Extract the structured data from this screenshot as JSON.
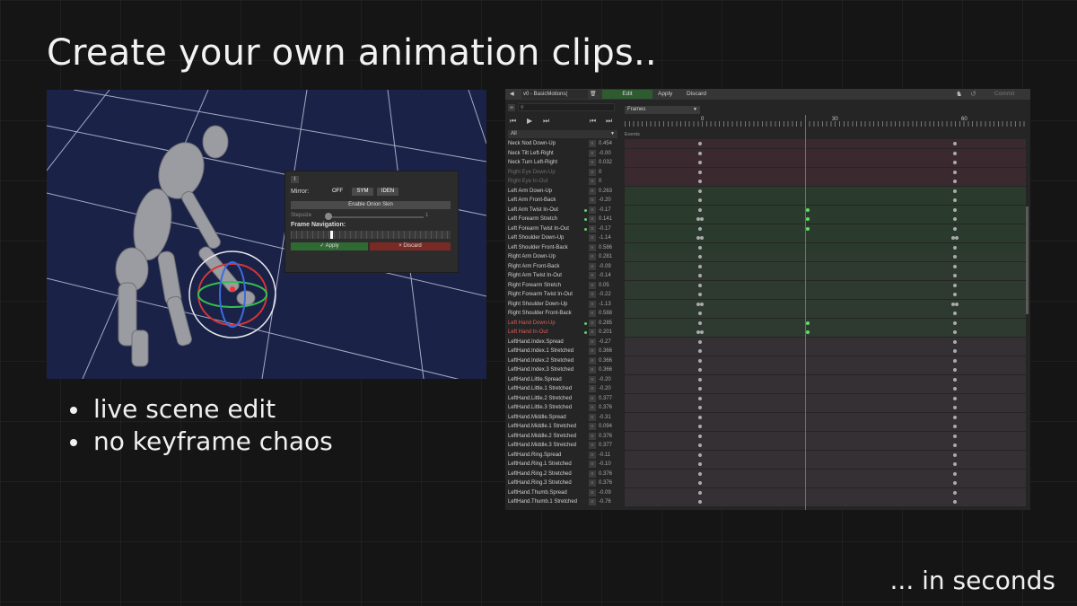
{
  "slide": {
    "title": "Create your own animation clips..",
    "bullets": [
      "live scene edit",
      "no keyframe chaos"
    ],
    "tagline": "... in seconds"
  },
  "gizmo_panel": {
    "close_label": "I",
    "mirror_label": "Mirror:",
    "mirror_options": [
      "OFF",
      "SYM",
      "IDEN"
    ],
    "onion_skin_label": "Enable Onion Skin",
    "stepsize_label": "Stepsize",
    "stepsize_value": "1",
    "frame_nav_label": "Frame Navigation:",
    "apply_label": "✓ Apply",
    "discard_label": "× Discard"
  },
  "editor": {
    "clip_name": "v0 - BasicMotions(",
    "toolbar": {
      "edit": "Edit",
      "apply": "Apply",
      "discard": "Discard",
      "commit": "Commit"
    },
    "filter_value": "All",
    "frames_dropdown": "Frames",
    "ruler_labels": [
      "0",
      "30",
      "60"
    ],
    "events_label": "Events",
    "keyframe_columns": [
      0,
      30,
      60
    ],
    "tracks": [
      {
        "name": "Neck Nod Down-Up",
        "value": "0.454",
        "style": "",
        "keys": "k0 k60"
      },
      {
        "name": "Neck Tilt Left-Right",
        "value": "-0.00",
        "style": "",
        "keys": "k0 k60"
      },
      {
        "name": "Neck Turn Left-Right",
        "value": "0.032",
        "style": "",
        "keys": "k0 k60"
      },
      {
        "name": "Right Eye Down-Up",
        "value": "0",
        "style": "dim",
        "keys": "k0 k60"
      },
      {
        "name": "Right Eye In-Out",
        "value": "0",
        "style": "dim",
        "keys": "k0 k60"
      },
      {
        "name": "Left Arm Down-Up",
        "value": "0.263",
        "style": "",
        "keys": "k0 k60"
      },
      {
        "name": "Left Arm Front-Back",
        "value": "-0.20",
        "style": "",
        "keys": "k0 k60"
      },
      {
        "name": "Left Arm Twist In-Out",
        "value": "-0.17",
        "style": "key",
        "keys": "k0 g30 k60"
      },
      {
        "name": "Left Forearm Stretch",
        "value": "0.141",
        "style": "key",
        "keys": "kk0 g30 k60"
      },
      {
        "name": "Left Forearm Twist In-Out",
        "value": "-0.17",
        "style": "key",
        "keys": "k0 g30 k60"
      },
      {
        "name": "Left Shoulder Down-Up",
        "value": "-1.14",
        "style": "",
        "keys": "kk0 kk60"
      },
      {
        "name": "Left Shoulder Front-Back",
        "value": "0.586",
        "style": "",
        "keys": "k0 k60"
      },
      {
        "name": "Right Arm Down-Up",
        "value": "0.281",
        "style": "",
        "keys": "k0 k60"
      },
      {
        "name": "Right Arm Front-Back",
        "value": "-0.09",
        "style": "",
        "keys": "k0 k60"
      },
      {
        "name": "Right Arm Twist In-Out",
        "value": "-0.14",
        "style": "",
        "keys": "k0 k60"
      },
      {
        "name": "Right Forearm Stretch",
        "value": "0.05",
        "style": "",
        "keys": "k0 k60"
      },
      {
        "name": "Right Forearm Twist In-Out",
        "value": "-0.22",
        "style": "",
        "keys": "k0 k60"
      },
      {
        "name": "Right Shoulder Down-Up",
        "value": "-1.13",
        "style": "",
        "keys": "kk0 kk60"
      },
      {
        "name": "Right Shoulder Front-Back",
        "value": "0.588",
        "style": "",
        "keys": "k0 k60"
      },
      {
        "name": "Left Hand Down-Up",
        "value": "0.285",
        "style": "red key",
        "keys": "k0 g30 k60"
      },
      {
        "name": "Left Hand In-Out",
        "value": "0.201",
        "style": "red key",
        "keys": "kk0 g30 k60"
      },
      {
        "name": "LeftHand.Index.Spread",
        "value": "-0.27",
        "style": "",
        "keys": "k0 k60"
      },
      {
        "name": "LeftHand.Index.1 Stretched",
        "value": "0.366",
        "style": "",
        "keys": "k0 k60"
      },
      {
        "name": "LeftHand.Index.2 Stretched",
        "value": "0.366",
        "style": "",
        "keys": "k0 k60"
      },
      {
        "name": "LeftHand.Index.3 Stretched",
        "value": "0.366",
        "style": "",
        "keys": "k0 k60"
      },
      {
        "name": "LeftHand.Little.Spread",
        "value": "-0.20",
        "style": "",
        "keys": "k0 k60"
      },
      {
        "name": "LeftHand.Little.1 Stretched",
        "value": "-0.20",
        "style": "",
        "keys": "k0 k60"
      },
      {
        "name": "LeftHand.Little.2 Stretched",
        "value": "0.377",
        "style": "",
        "keys": "k0 k60"
      },
      {
        "name": "LeftHand.Little.3 Stretched",
        "value": "0.376",
        "style": "",
        "keys": "k0 k60"
      },
      {
        "name": "LeftHand.Middle.Spread",
        "value": "-0.31",
        "style": "",
        "keys": "k0 k60"
      },
      {
        "name": "LeftHand.Middle.1 Stretched",
        "value": "0.094",
        "style": "",
        "keys": "k0 k60"
      },
      {
        "name": "LeftHand.Middle.2 Stretched",
        "value": "0.376",
        "style": "",
        "keys": "k0 k60"
      },
      {
        "name": "LeftHand.Middle.3 Stretched",
        "value": "0.377",
        "style": "",
        "keys": "k0 k60"
      },
      {
        "name": "LeftHand.Ring.Spread",
        "value": "-0.11",
        "style": "",
        "keys": "k0 k60"
      },
      {
        "name": "LeftHand.Ring.1 Stretched",
        "value": "-0.10",
        "style": "",
        "keys": "k0 k60"
      },
      {
        "name": "LeftHand.Ring.2 Stretched",
        "value": "0.376",
        "style": "",
        "keys": "k0 k60"
      },
      {
        "name": "LeftHand.Ring.3 Stretched",
        "value": "0.376",
        "style": "",
        "keys": "k0 k60"
      },
      {
        "name": "LeftHand.Thumb.Spread",
        "value": "-0.09",
        "style": "",
        "keys": "k0 k60"
      },
      {
        "name": "LeftHand.Thumb.1 Stretched",
        "value": "-0.76",
        "style": "",
        "keys": "k0 k60"
      }
    ],
    "lane_colors": [
      "#3a2a30",
      "#2a3a2c",
      "#2e3a30",
      "#343034"
    ]
  }
}
